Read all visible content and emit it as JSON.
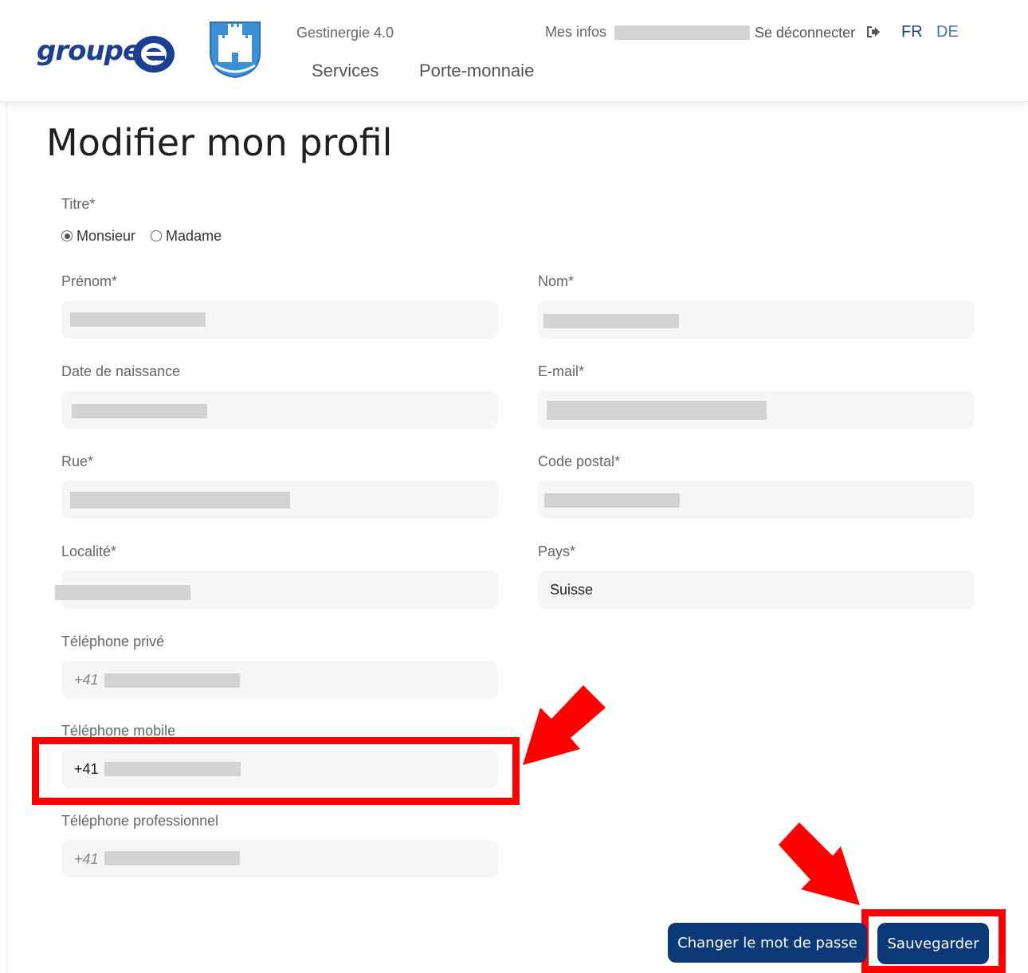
{
  "header": {
    "brand": "groupe",
    "app_name": "Gestinergie 4.0",
    "nav": [
      "Services",
      "Porte-monnaie"
    ],
    "my_infos": "Mes infos",
    "logout": "Se déconnecter",
    "languages": [
      "FR",
      "DE"
    ],
    "active_language": "FR"
  },
  "page": {
    "title": "Modifier mon profil"
  },
  "form": {
    "title_label": "Titre*",
    "title_options": [
      "Monsieur",
      "Madame"
    ],
    "title_selected": "Monsieur",
    "first_name_label": "Prénom*",
    "last_name_label": "Nom*",
    "birth_date_label": "Date de naissance",
    "email_label": "E-mail*",
    "street_label": "Rue*",
    "postal_code_label": "Code postal*",
    "locality_label": "Localité*",
    "country_label": "Pays*",
    "country_value": "Suisse",
    "phone_private_label": "Téléphone privé",
    "phone_private_prefix": "+41",
    "phone_mobile_label": "Téléphone mobile",
    "phone_mobile_prefix": "+41",
    "phone_work_label": "Téléphone professionnel",
    "phone_work_prefix": "+41"
  },
  "actions": {
    "change_password": "Changer le mot de passe",
    "save": "Sauvegarder"
  },
  "colors": {
    "brand_blue": "#1c3f8f",
    "button_blue": "#0b3978",
    "annotation_red": "#ff0000",
    "field_background": "#f6f6f6",
    "redaction_gray": "#d3d3d3"
  }
}
